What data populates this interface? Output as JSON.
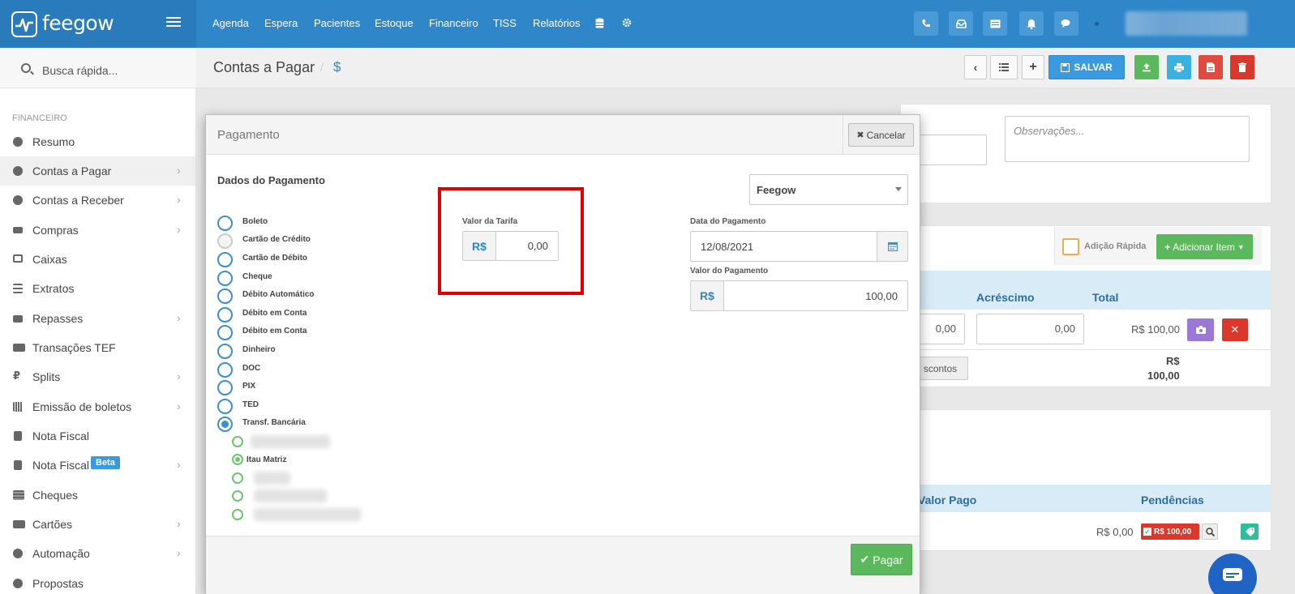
{
  "app": {
    "name": "feegow",
    "nav": [
      "Agenda",
      "Espera",
      "Pacientes",
      "Estoque",
      "Financeiro",
      "TISS",
      "Relatórios"
    ],
    "top_icons": [
      "phone-icon",
      "inbox-icon",
      "card-icon",
      "bell-icon",
      "chat-icon"
    ]
  },
  "sidebar": {
    "search_placeholder": "Busca rápida...",
    "section": "FINANCEIRO",
    "items": [
      {
        "label": "Resumo",
        "icon": "pie-chart-icon",
        "chevron": false
      },
      {
        "label": "Contas a Pagar",
        "icon": "arrow-up-circle-icon",
        "chevron": true,
        "active": true
      },
      {
        "label": "Contas a Receber",
        "icon": "arrow-down-circle-icon",
        "chevron": true
      },
      {
        "label": "Compras",
        "icon": "cart-icon",
        "chevron": true
      },
      {
        "label": "Caixas",
        "icon": "inbox-icon",
        "chevron": false
      },
      {
        "label": "Extratos",
        "icon": "list-icon",
        "chevron": false
      },
      {
        "label": "Repasses",
        "icon": "sitemap-icon",
        "chevron": true
      },
      {
        "label": "Transações TEF",
        "icon": "credit-card-icon",
        "chevron": false
      },
      {
        "label": "Splits",
        "icon": "currency-icon",
        "chevron": true
      },
      {
        "label": "Emissão de boletos",
        "icon": "barcode-icon",
        "chevron": true
      },
      {
        "label": "Nota Fiscal",
        "icon": "file-icon",
        "chevron": false
      },
      {
        "label": "Nota Fiscal",
        "icon": "file-icon",
        "chevron": true,
        "badge": "Beta"
      },
      {
        "label": "Cheques",
        "icon": "list-alt-icon",
        "chevron": false
      },
      {
        "label": "Cartões",
        "icon": "credit-card-icon",
        "chevron": true
      },
      {
        "label": "Automação",
        "icon": "gears-icon",
        "chevron": true
      },
      {
        "label": "Propostas",
        "icon": "document-icon",
        "chevron": false
      }
    ]
  },
  "page": {
    "title": "Contas a Pagar",
    "separator": "/",
    "subtitle_symbol": "$",
    "save_label": "SALVAR",
    "observations_placeholder": "Observações..."
  },
  "background": {
    "quick_add_label": "Adição Rápida",
    "add_item_label": "Adicionar Item",
    "col_acrescimo": "Acréscimo",
    "col_total": "Total",
    "row_value_1": "0,00",
    "row_value_2": "0,00",
    "row_total": "R$ 100,00",
    "discounts_label": "scontos",
    "total_label": "R$",
    "total_value": "100,00",
    "col_valor_pago": "Valor Pago",
    "col_pendencias": "Pendências",
    "paid_value": "R$ 0,00",
    "pending_badge": "R$ 100,00"
  },
  "modal": {
    "title": "Pagamento",
    "cancel_label": "Cancelar",
    "section_title": "Dados do Pagamento",
    "payment_methods": [
      {
        "label": "Boleto",
        "state": "unchecked"
      },
      {
        "label": "Cartão de Crédito",
        "state": "disabled"
      },
      {
        "label": "Cartão de Débito",
        "state": "unchecked"
      },
      {
        "label": "Cheque",
        "state": "unchecked"
      },
      {
        "label": "Débito Automático",
        "state": "unchecked"
      },
      {
        "label": "Débito em Conta",
        "state": "unchecked"
      },
      {
        "label": "Débito em Conta",
        "state": "unchecked"
      },
      {
        "label": "Dinheiro",
        "state": "unchecked"
      },
      {
        "label": "DOC",
        "state": "unchecked"
      },
      {
        "label": "PIX",
        "state": "unchecked"
      },
      {
        "label": "TED",
        "state": "unchecked"
      },
      {
        "label": "Transf. Bancária",
        "state": "checked"
      }
    ],
    "bank_accounts": [
      {
        "label": "",
        "blurred": true,
        "checked": false
      },
      {
        "label": "Itau Matriz",
        "blurred": false,
        "checked": true
      },
      {
        "label": "",
        "blurred": true,
        "checked": false
      },
      {
        "label": "",
        "blurred": true,
        "checked": false
      },
      {
        "label": "",
        "blurred": true,
        "checked": false
      }
    ],
    "tarifa_label": "Valor da Tarifa",
    "currency_addon": "R$",
    "tarifa_value": "0,00",
    "account_select": "Feegow",
    "date_label": "Data do Pagamento",
    "date_value": "12/08/2021",
    "amount_label": "Valor do Pagamento",
    "amount_value": "100,00",
    "pay_label": "Pagar"
  }
}
